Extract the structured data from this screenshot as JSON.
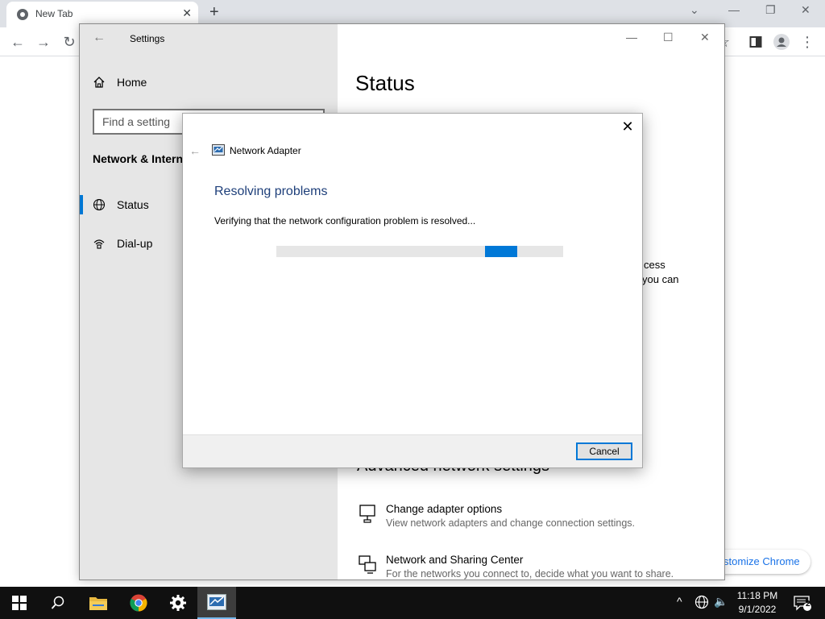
{
  "chrome": {
    "tab_title": "New Tab",
    "customize_label": "stomize Chrome"
  },
  "settings": {
    "title": "Settings",
    "home_label": "Home",
    "search_placeholder": "Find a setting",
    "section_title": "Network & Interne",
    "nav_items": [
      {
        "label": "Status"
      },
      {
        "label": "Dial-up"
      }
    ],
    "main": {
      "heading": "Status",
      "partial_line_1": "cess",
      "partial_line_2": "you can",
      "advanced_heading": "Advanced network settings",
      "links": [
        {
          "title": "Change adapter options",
          "desc": "View network adapters and change connection settings."
        },
        {
          "title": "Network and Sharing Center",
          "desc": "For the networks you connect to, decide what you want to share."
        }
      ]
    }
  },
  "dialog": {
    "app_title": "Network Adapter",
    "heading": "Resolving problems",
    "message": "Verifying that the network configuration problem is resolved...",
    "cancel_label": "Cancel",
    "progress_position": 0.82
  },
  "taskbar": {
    "time": "11:18 PM",
    "date": "9/1/2022",
    "notification_count": "2"
  },
  "colors": {
    "accent": "#0078d7",
    "dialog_heading": "#1e3f7a",
    "taskbar": "#101010"
  }
}
